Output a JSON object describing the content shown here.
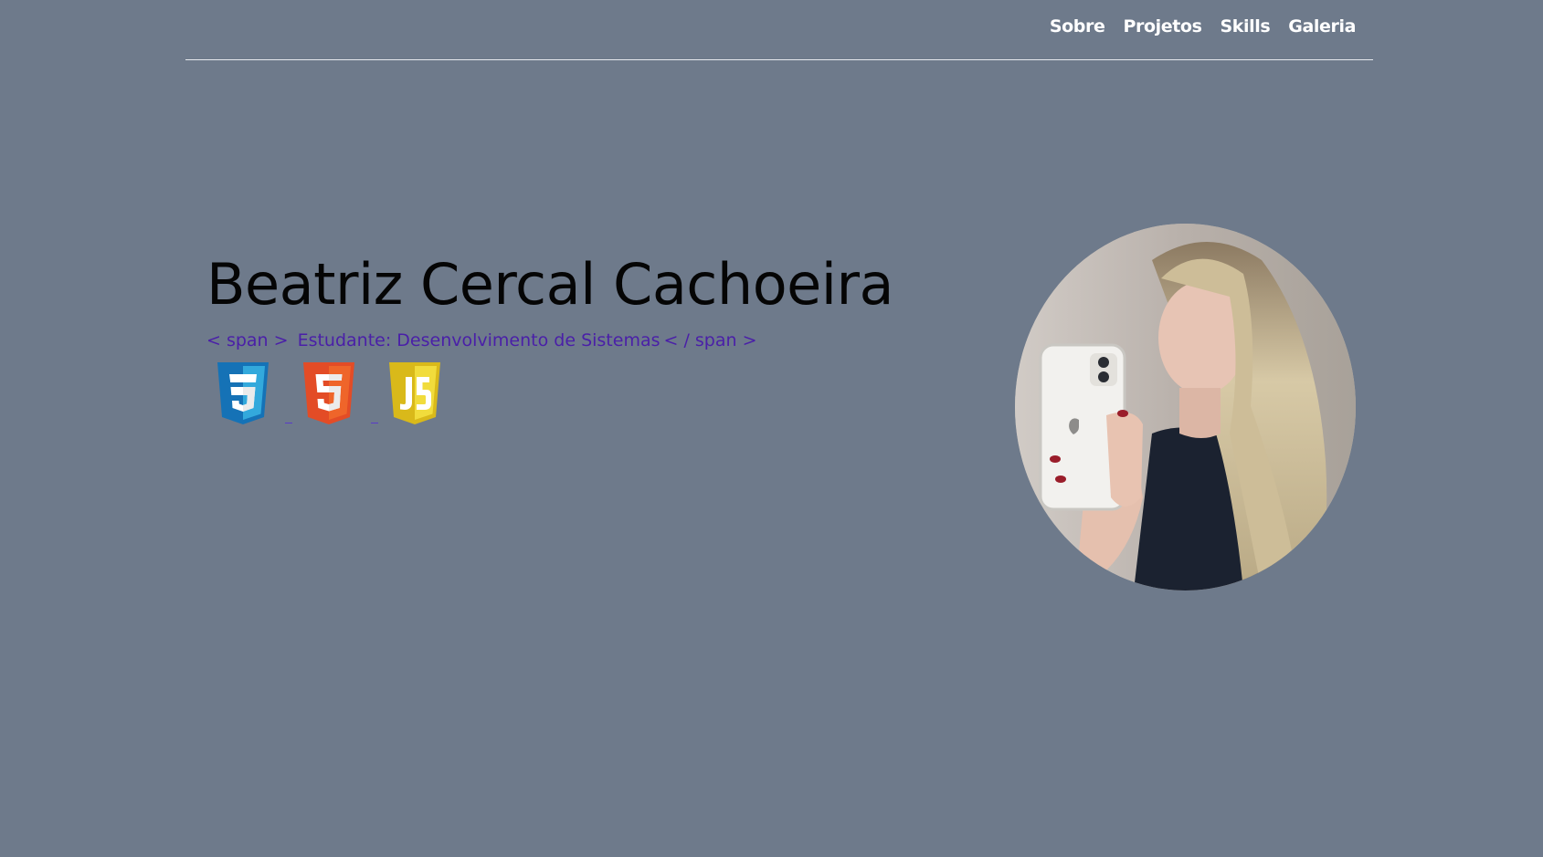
{
  "nav": {
    "items": [
      {
        "label": "Sobre"
      },
      {
        "label": "Projetos"
      },
      {
        "label": "Skills"
      },
      {
        "label": "Galeria"
      }
    ]
  },
  "hero": {
    "title": "Beatriz Cercal Cachoeira",
    "subtitle_open_tag": "< span >",
    "subtitle_text": "Estudante: Desenvolvimento de Sistemas",
    "subtitle_close_tag": "< / span >"
  },
  "skills": {
    "icons": [
      {
        "name": "css3-icon",
        "color": "#2a7ae2"
      },
      {
        "name": "html5-icon",
        "color": "#e34c26"
      },
      {
        "name": "javascript-icon",
        "color": "#f0d21c"
      }
    ]
  },
  "colors": {
    "background": "#6e7a8b",
    "nav_text": "#ffffff",
    "title_text": "#050505",
    "subtitle_text": "#4a1fa8"
  }
}
